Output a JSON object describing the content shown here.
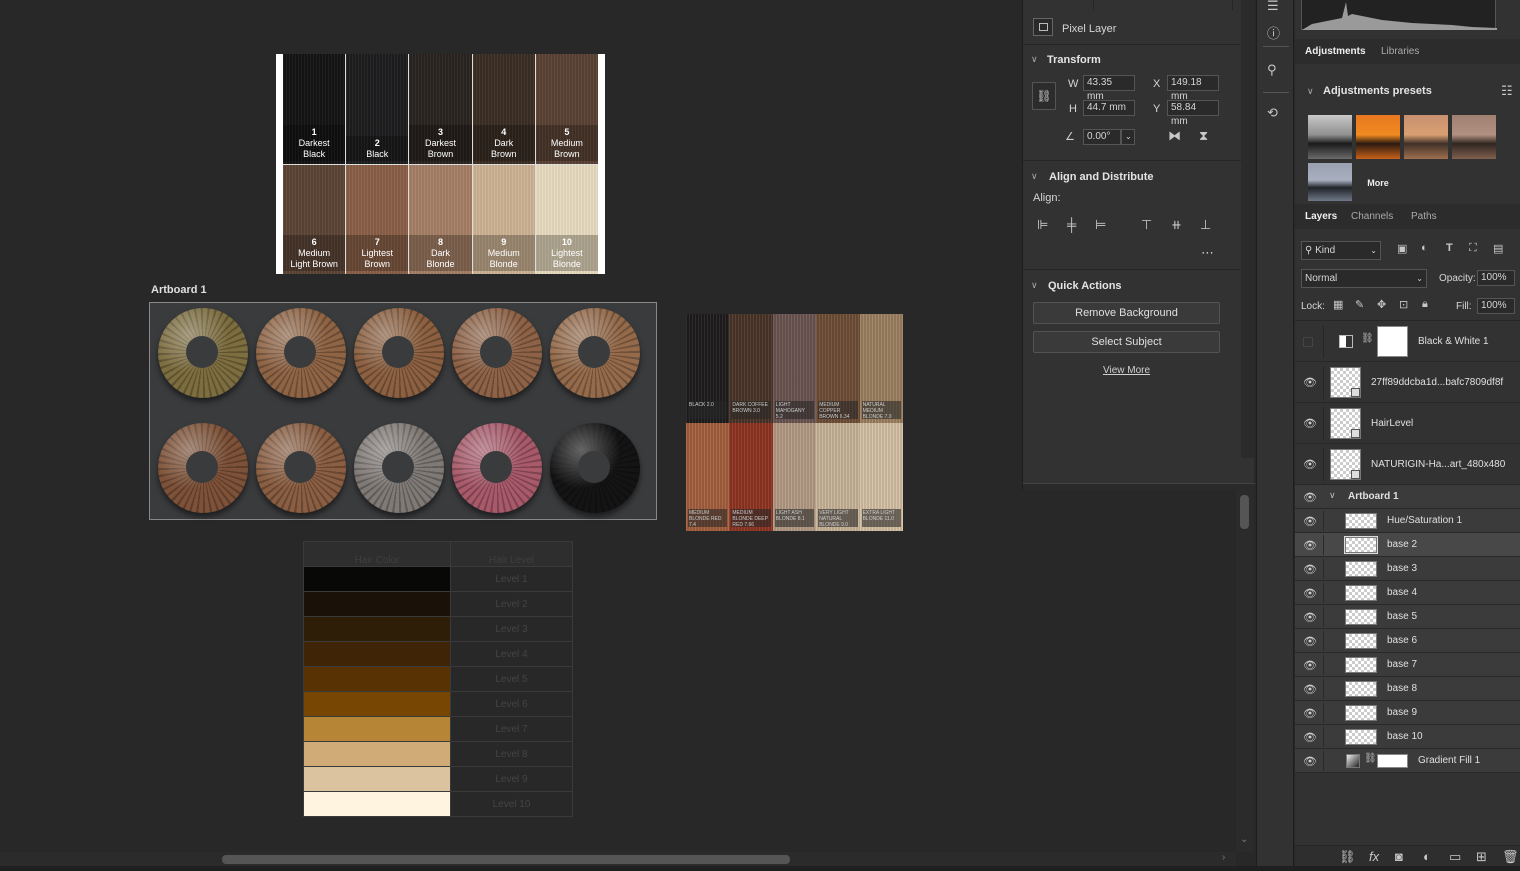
{
  "reference_chart": {
    "cells": [
      {
        "num": "1",
        "name1": "Darkest",
        "name2": "Black",
        "color": "#141414"
      },
      {
        "num": "2",
        "name1": "",
        "name2": "Black",
        "color": "#1e1e1f"
      },
      {
        "num": "3",
        "name1": "Darkest",
        "name2": "Brown",
        "color": "#2a2421"
      },
      {
        "num": "4",
        "name1": "Dark",
        "name2": "Brown",
        "color": "#3a2d24"
      },
      {
        "num": "5",
        "name1": "Medium",
        "name2": "Brown",
        "color": "#5a4234"
      },
      {
        "num": "6",
        "name1": "Medium",
        "name2": "Light Brown",
        "color": "#5c4436"
      },
      {
        "num": "7",
        "name1": "Lightest",
        "name2": "Brown",
        "color": "#8a6048"
      },
      {
        "num": "8",
        "name1": "Dark",
        "name2": "Blonde",
        "color": "#a57f66"
      },
      {
        "num": "9",
        "name1": "Medium",
        "name2": "Blonde",
        "color": "#cdb394"
      },
      {
        "num": "10",
        "name1": "Lightest",
        "name2": "Blonde",
        "color": "#e8dcc0"
      }
    ]
  },
  "artboard": {
    "title": "Artboard 1",
    "curls": [
      "#7d6e40",
      "#8f6445",
      "#8c6040",
      "#8e6246",
      "#946a4a",
      "#7e5238",
      "#8a5e42",
      "#807a76",
      "#a85a6a",
      "#141414"
    ]
  },
  "strand_photo": {
    "strands": [
      {
        "label": "BLACK 2.0",
        "color": "#1e1c1c"
      },
      {
        "label": "DARK COFFEE BROWN 3.0",
        "color": "#4a3428"
      },
      {
        "label": "LIGHT MAHOGANY 5.2",
        "color": "#6a5450"
      },
      {
        "label": "MEDIUM COPPER BROWN 6.34",
        "color": "#6e4e36"
      },
      {
        "label": "NATURAL MEDIUM BLONDE 7.0",
        "color": "#9c8060"
      },
      {
        "label": "MEDIUM BLONDE RED 7.4",
        "color": "#a4603e"
      },
      {
        "label": "MEDIUM BLONDE DEEP RED 7.66",
        "color": "#8e3422"
      },
      {
        "label": "LIGHT ASH BLONDE 8.1",
        "color": "#b39a84"
      },
      {
        "label": "VERY LIGHT NATURAL BLONDE 9.0",
        "color": "#c8b498"
      },
      {
        "label": "EXTRA LIGHT BLONDE 11.0",
        "color": "#d4c0a4"
      }
    ]
  },
  "level_table": {
    "headers": [
      "Hair Color",
      "Hair Level"
    ],
    "rows": [
      {
        "level": "Level 1",
        "color": "#080807"
      },
      {
        "level": "Level 2",
        "color": "#1a1109"
      },
      {
        "level": "Level 3",
        "color": "#2e1d07"
      },
      {
        "level": "Level 4",
        "color": "#3f2406"
      },
      {
        "level": "Level 5",
        "color": "#593204"
      },
      {
        "level": "Level 6",
        "color": "#774603"
      },
      {
        "level": "Level 7",
        "color": "#b78536"
      },
      {
        "level": "Level 8",
        "color": "#d1ab77"
      },
      {
        "level": "Level 9",
        "color": "#dcc39f"
      },
      {
        "level": "Level 10",
        "color": "#fff4e0"
      }
    ]
  },
  "properties": {
    "layer_type": "Pixel Layer",
    "transform": {
      "title": "Transform",
      "w_label": "W",
      "w": "43.35 mm",
      "h_label": "H",
      "h": "44.7 mm",
      "x_label": "X",
      "x": "149.18 mm",
      "y_label": "Y",
      "y": "58.84 mm",
      "angle": "0.00°"
    },
    "align": {
      "title": "Align and Distribute",
      "sublabel": "Align:"
    },
    "quick_actions": {
      "title": "Quick Actions",
      "remove_bg": "Remove Background",
      "select_subject": "Select Subject",
      "view_more": "View More"
    }
  },
  "adjustments": {
    "tabs": [
      "Adjustments",
      "Libraries"
    ],
    "presets_title": "Adjustments presets",
    "more_label": "More"
  },
  "layers_panel": {
    "tabs": [
      "Layers",
      "Channels",
      "Paths"
    ],
    "kind_label": "Kind",
    "blend_mode": "Normal",
    "opacity_label": "Opacity:",
    "opacity": "100%",
    "lock_label": "Lock:",
    "fill_label": "Fill:",
    "fill": "100%",
    "layers": [
      {
        "name": "Black & White 1",
        "kind": "adjustment",
        "visible": false
      },
      {
        "name": "27ff89ddcba1d...bafc7809df8f",
        "kind": "smart",
        "visible": true
      },
      {
        "name": "HairLevel",
        "kind": "smart",
        "visible": true
      },
      {
        "name": "NATURIGIN-Ha...art_480x480",
        "kind": "smart",
        "visible": true
      }
    ],
    "group": {
      "name": "Artboard 1"
    },
    "group_layers": [
      {
        "name": "Hue/Saturation 1",
        "selected": false
      },
      {
        "name": "base 2",
        "selected": true
      },
      {
        "name": "base 3",
        "selected": false
      },
      {
        "name": "base 4",
        "selected": false
      },
      {
        "name": "base 5",
        "selected": false
      },
      {
        "name": "base 6",
        "selected": false
      },
      {
        "name": "base 7",
        "selected": false
      },
      {
        "name": "base 8",
        "selected": false
      },
      {
        "name": "base 9",
        "selected": false
      },
      {
        "name": "base 10",
        "selected": false
      },
      {
        "name": "Gradient Fill 1",
        "selected": false
      }
    ]
  }
}
